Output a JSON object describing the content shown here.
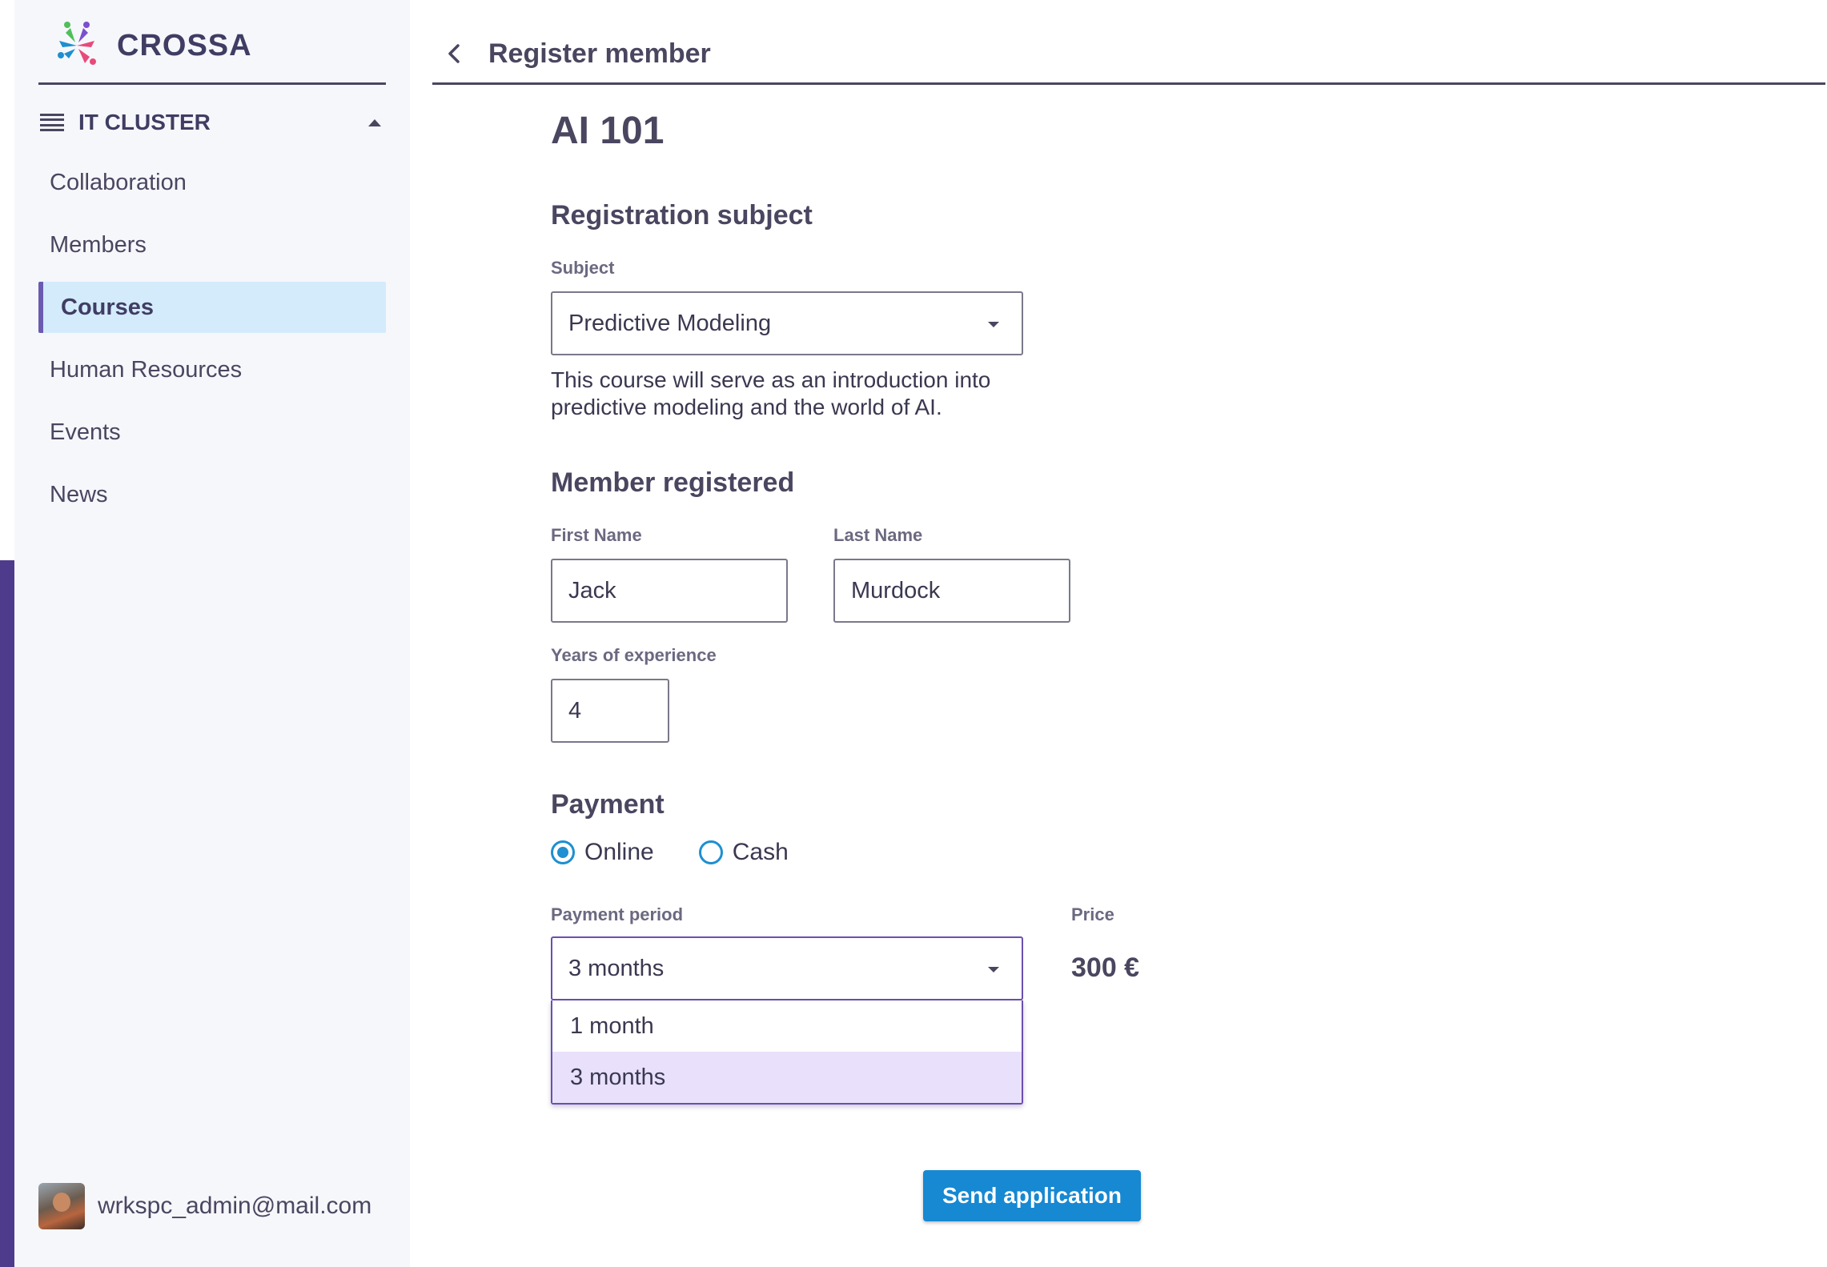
{
  "app": {
    "logo_text": "CROSSA"
  },
  "sidebar": {
    "group_label": "IT CLUSTER",
    "items": [
      {
        "label": "Collaboration",
        "active": false
      },
      {
        "label": "Members",
        "active": false
      },
      {
        "label": "Courses",
        "active": true
      },
      {
        "label": "Human Resources",
        "active": false
      },
      {
        "label": "Events",
        "active": false
      },
      {
        "label": "News",
        "active": false
      }
    ],
    "user_email": "wrkspc_admin@mail.com"
  },
  "header": {
    "title": "Register member"
  },
  "form": {
    "course_title": "AI 101",
    "registration": {
      "section_title": "Registration subject",
      "subject_label": "Subject",
      "subject_value": "Predictive Modeling",
      "description": "This course will serve as an introduction into predictive modeling and the world of AI."
    },
    "member": {
      "section_title": "Member registered",
      "first_name_label": "First Name",
      "first_name_value": "Jack",
      "last_name_label": "Last Name",
      "last_name_value": "Murdock",
      "experience_label": "Years of experience",
      "experience_value": "4"
    },
    "payment": {
      "section_title": "Payment",
      "options": [
        {
          "label": "Online",
          "selected": true
        },
        {
          "label": "Cash",
          "selected": false
        }
      ],
      "period_label": "Payment period",
      "period_value": "3 months",
      "period_options": [
        {
          "label": "1 month",
          "selected": false
        },
        {
          "label": "3 months",
          "selected": true
        }
      ],
      "price_label": "Price",
      "price_value": "300 €"
    },
    "submit_label": "Send application"
  },
  "colors": {
    "sidebar_bg": "#f6f7fb",
    "active_item_bg": "#d4ebfb",
    "accent_purple": "#6a4fb0",
    "primary_blue": "#1788d2",
    "selected_option_bg": "#e9e1fb",
    "text": "#4a4660"
  }
}
